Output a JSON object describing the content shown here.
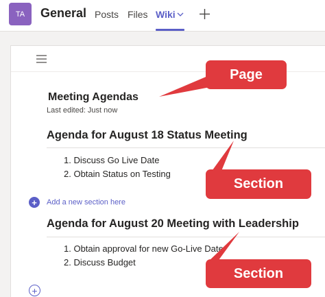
{
  "header": {
    "avatar_initials": "TA",
    "channel_name": "General",
    "tabs": [
      {
        "label": "Posts"
      },
      {
        "label": "Files"
      },
      {
        "label": "Wiki"
      }
    ],
    "accent_color": "#5b5fc7",
    "add_tab_icon": "plus-icon",
    "wiki_menu_icon": "chevron-down-icon"
  },
  "toolbar": {
    "menu_icon": "hamburger-icon"
  },
  "page": {
    "title": "Meeting Agendas",
    "last_edited": "Last edited: Just now",
    "sections": [
      {
        "heading": "Agenda for August 18 Status Meeting",
        "items": [
          "1. Discuss Go Live Date",
          "2. Obtain Status on Testing"
        ]
      },
      {
        "heading": "Agenda for August 20 Meeting with Leadership",
        "items": [
          "1. Obtain approval for new Go-Live Date",
          "2. Discuss Budget"
        ]
      }
    ],
    "add_section_label": "Add a new section here"
  },
  "callouts": {
    "color": "#e03a3e",
    "page_label": "Page",
    "section_label_1": "Section",
    "section_label_2": "Section"
  }
}
